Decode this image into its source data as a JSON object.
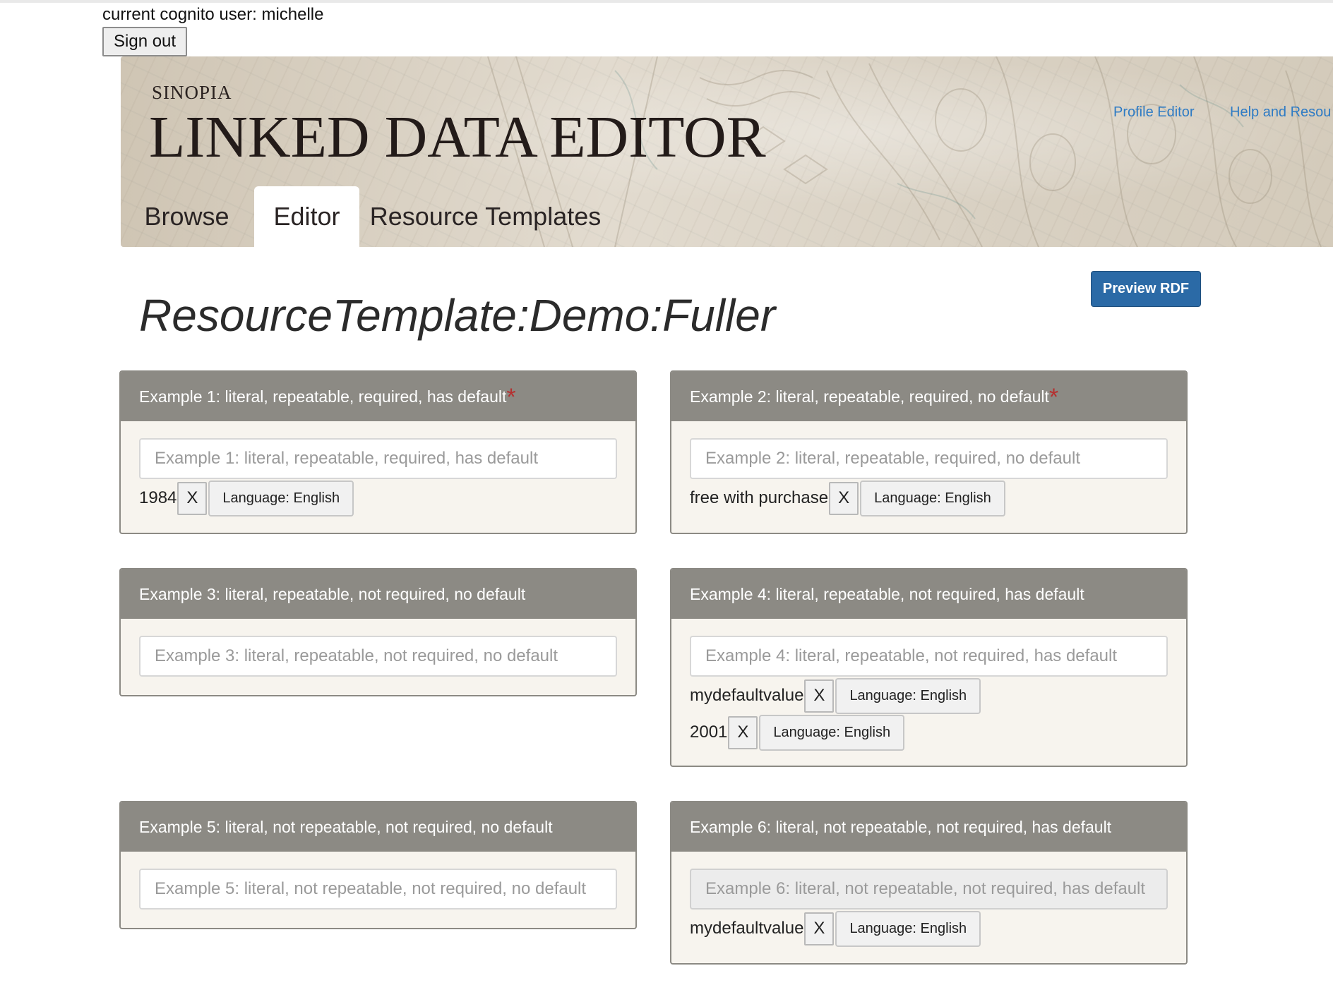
{
  "session": {
    "user_line": "current cognito user: michelle",
    "sign_out_label": "Sign out"
  },
  "header": {
    "brand_small": "SINOPIA",
    "brand_big": "LINKED DATA EDITOR",
    "links": [
      "Profile Editor",
      "Help and Resou"
    ],
    "tabs": [
      "Browse",
      "Editor",
      "Resource Templates"
    ],
    "active_tab": "Editor",
    "link_color": "#2e7bc4"
  },
  "toolbar": {
    "preview_label": "Preview RDF",
    "preview_color": "#2b6aa6"
  },
  "page": {
    "title": "ResourceTemplate:Demo:Fuller"
  },
  "panels": [
    {
      "title": "Example 1: literal, repeatable, required, has default",
      "required": true,
      "placeholder": "Example 1: literal, repeatable, required, has default",
      "disabled": false,
      "values": [
        {
          "text": "1984",
          "remove": "X",
          "language": "Language: English"
        }
      ]
    },
    {
      "title": "Example 2: literal, repeatable, required, no default",
      "required": true,
      "placeholder": "Example 2: literal, repeatable, required, no default",
      "disabled": false,
      "values": [
        {
          "text": "free with purchase",
          "remove": "X",
          "language": "Language: English"
        }
      ]
    },
    {
      "title": "Example 3: literal, repeatable, not required, no default",
      "required": false,
      "placeholder": "Example 3: literal, repeatable, not required, no default",
      "disabled": false,
      "values": []
    },
    {
      "title": "Example 4: literal, repeatable, not required, has default",
      "required": false,
      "placeholder": "Example 4: literal, repeatable, not required, has default",
      "disabled": false,
      "values": [
        {
          "text": "mydefaultvalue",
          "remove": "X",
          "language": "Language: English"
        },
        {
          "text": "2001",
          "remove": "X",
          "language": "Language: English"
        }
      ]
    },
    {
      "title": "Example 5: literal, not repeatable, not required, no default",
      "required": false,
      "placeholder": "Example 5: literal, not repeatable, not required, no default",
      "disabled": false,
      "values": []
    },
    {
      "title": "Example 6: literal, not repeatable, not required, has default",
      "required": false,
      "placeholder": "Example 6: literal, not repeatable, not required, has default",
      "disabled": true,
      "values": [
        {
          "text": "mydefaultvalue",
          "remove": "X",
          "language": "Language: English"
        }
      ]
    }
  ],
  "colors": {
    "panel_header": "#8c8a84",
    "panel_body": "#f7f4ee",
    "required_star": "#b53030"
  }
}
